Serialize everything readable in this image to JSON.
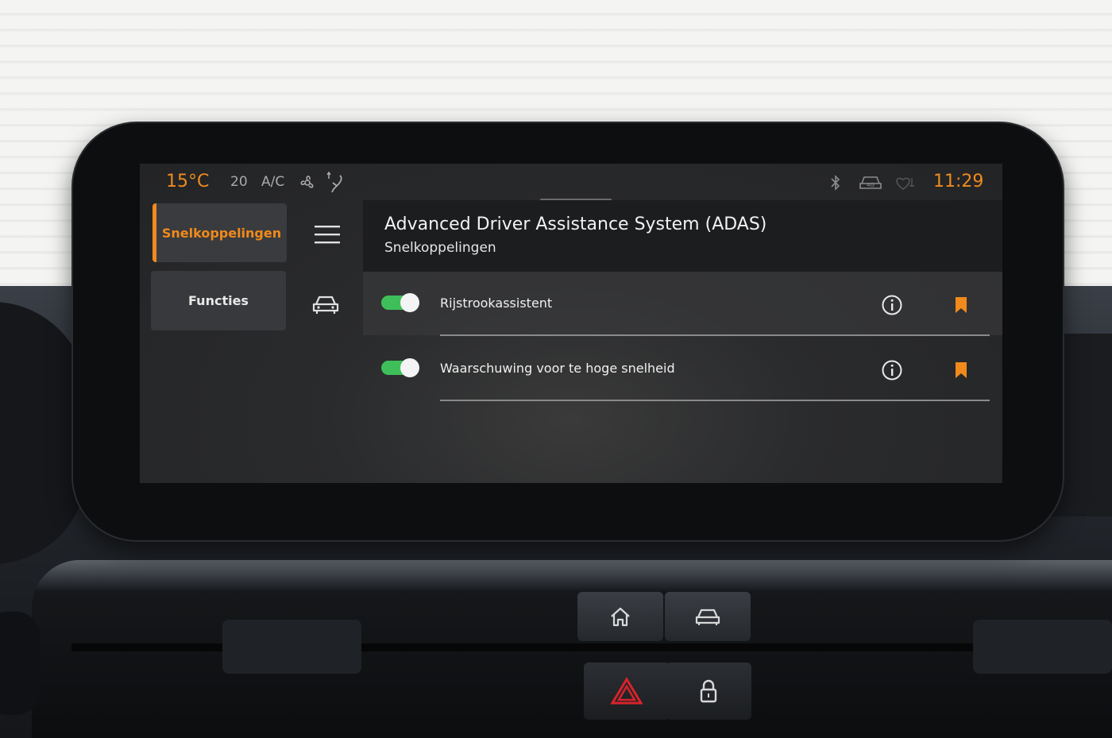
{
  "status_bar": {
    "temperature": "15°C",
    "fan_speed": "20",
    "ac_label": "A/C",
    "clock": "11:29",
    "icons": [
      "fan-icon",
      "seat-airflow-icon",
      "bluetooth-icon",
      "car-4g-icon",
      "heart-icon"
    ]
  },
  "tabs": {
    "shortcuts": "Snelkoppelingen",
    "functions": "Functies"
  },
  "header": {
    "title": "Advanced Driver Assistance System (ADAS)",
    "subtitle": "Snelkoppelingen"
  },
  "rows": [
    {
      "label": "Rijstrookassistent",
      "enabled": true
    },
    {
      "label": "Waarschuwing voor te hoge snelheid",
      "enabled": true
    }
  ],
  "colors": {
    "accent": "#f08a1c",
    "toggle_on": "#3fbf5a",
    "hazard": "#d8232a"
  }
}
